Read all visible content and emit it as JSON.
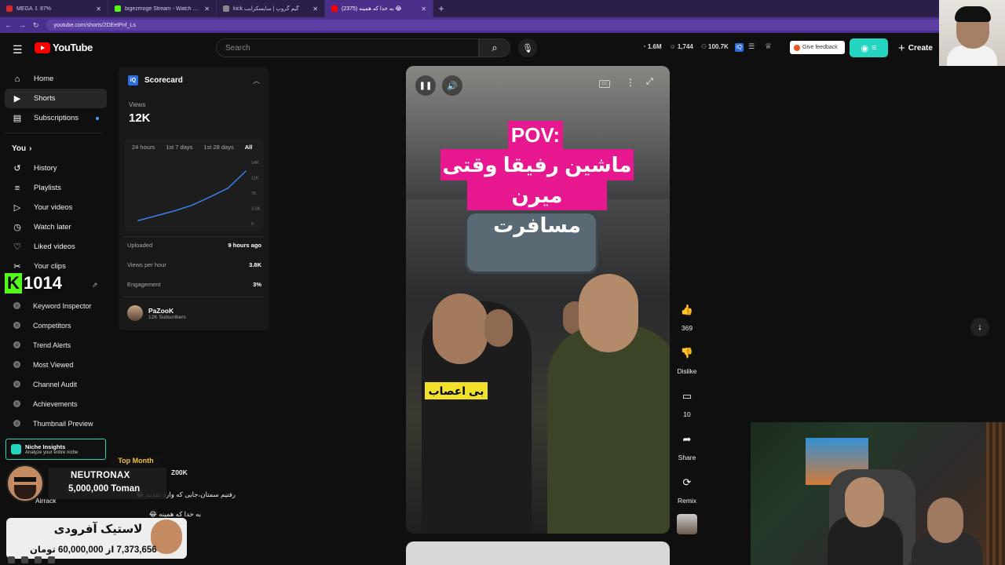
{
  "browser": {
    "tabs": [
      {
        "title": "MEGA ⇩ 87%",
        "color": "#d9272e",
        "active": false
      },
      {
        "title": "bigezmoge Stream - Watch Live",
        "color": "#53fc18",
        "active": false
      },
      {
        "title": "kick گیم گروپ | سایسکرایب",
        "color": "#888888",
        "active": false
      },
      {
        "title": "(2375) به خدا که همینه 😂",
        "color": "#ff0000",
        "active": true
      }
    ],
    "url": "youtube.com/shorts/2DEeIPnf_Ls"
  },
  "header": {
    "logo_text": "YouTube",
    "search_placeholder": "Search",
    "stats": [
      {
        "icon": "eye-icon",
        "value": "1.6M"
      },
      {
        "icon": "user-icon",
        "value": "1,744"
      },
      {
        "icon": "group-icon",
        "value": "100.7K"
      }
    ],
    "feedback_label": "Give feedback",
    "create_label": "Create"
  },
  "sidebar": {
    "items": [
      {
        "icon": "home-icon",
        "glyph": "⌂",
        "label": "Home",
        "active": false
      },
      {
        "icon": "shorts-icon",
        "glyph": "▶",
        "label": "Shorts",
        "active": true
      },
      {
        "icon": "subscriptions-icon",
        "glyph": "▤",
        "label": "Subscriptions",
        "active": false
      }
    ],
    "you_label": "You",
    "you_items": [
      {
        "icon": "history-icon",
        "glyph": "↺",
        "label": "History"
      },
      {
        "icon": "playlists-icon",
        "glyph": "≡",
        "label": "Playlists"
      },
      {
        "icon": "your-videos-icon",
        "glyph": "▷",
        "label": "Your videos"
      },
      {
        "icon": "watch-later-icon",
        "glyph": "◷",
        "label": "Watch later"
      },
      {
        "icon": "liked-videos-icon",
        "glyph": "♡",
        "label": "Liked videos"
      },
      {
        "icon": "clips-icon",
        "glyph": "✂",
        "label": "Your clips"
      }
    ],
    "tools": [
      {
        "label": "Keyword Inspector"
      },
      {
        "label": "Competitors"
      },
      {
        "label": "Trend Alerts"
      },
      {
        "label": "Most Viewed"
      },
      {
        "label": "Channel Audit"
      },
      {
        "label": "Achievements"
      },
      {
        "label": "Thumbnail Preview"
      }
    ],
    "niche_title": "Niche Insights",
    "niche_sub": "Analyze your entire niche",
    "kick_letter": "K",
    "kick_count": "1014"
  },
  "scorecard": {
    "title": "Scorecard",
    "views_label": "Views",
    "views_value": "12K",
    "tabs": [
      "24 hours",
      "1st 7 days",
      "1st 28 days",
      "All"
    ],
    "active_tab": "All",
    "y_ticks": [
      "14K",
      "11K",
      "7K",
      "3.5K",
      "0"
    ],
    "rows": [
      {
        "label": "Uploaded",
        "value": "9 hours ago"
      },
      {
        "label": "Views per hour",
        "value": "3.8K"
      },
      {
        "label": "Engagement",
        "value": "3%"
      }
    ],
    "channel_name": "PaZooK",
    "channel_subs": "12K Subscribers",
    "chart_data": {
      "type": "line",
      "y": [
        700,
        1800,
        2900,
        4200,
        6100,
        8100,
        12000
      ],
      "ylim": [
        0,
        14000
      ],
      "grid": false
    }
  },
  "video": {
    "overlay_top": "POV:",
    "overlay_line2": "ماشین رفیقا وقتی",
    "overlay_line3": "میرن مسافرت",
    "tag_label": "بی اعصاب"
  },
  "actions": {
    "likes": "369",
    "dislike_label": "Dislike",
    "comments": "10",
    "share_label": "Share",
    "remix_label": "Remix"
  },
  "stream": {
    "top_month_label": "Top Month",
    "donor_name": "NEUTRONAX",
    "donor_amount": "5,000,000 Toman",
    "goal_title": "لاستیک آفرودی",
    "goal_amount": "7,373,656 از 60,000,000 تومان",
    "comment_lines": [
      "Z00K",
      "رفتیم سمتان،جایی که وارد شدیم 😂",
      "Airrack",
      "به خدا که همینه 😂"
    ]
  }
}
